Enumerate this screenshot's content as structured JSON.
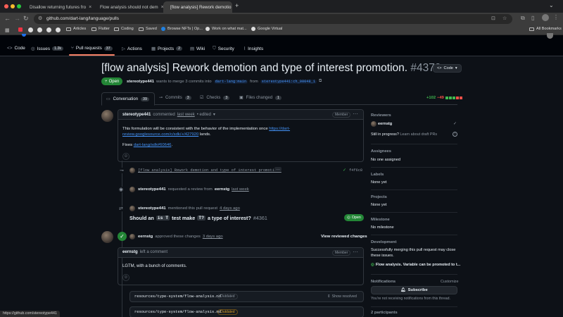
{
  "browser": {
    "tabs": [
      {
        "label": "Disallow returning futures fro"
      },
      {
        "label": "Flow analysis should not dem"
      },
      {
        "label": "[flow analysis] Rework demotio"
      }
    ],
    "new_tab": "+",
    "url": "github.com/dart-lang/language/pulls",
    "bookmarks": [
      "Articles",
      "Flutter",
      "Coding",
      "Saved",
      "Browse NFTs | Op...",
      "Work on what mat...",
      "Google Virtual"
    ],
    "all_bookmarks": "All Bookmarks",
    "status_url": "https://github.com/stereotype441"
  },
  "repo_nav": {
    "items": [
      {
        "label": "Code",
        "icon": "code-icon"
      },
      {
        "label": "Issues",
        "count": "1.2k",
        "icon": "issue-icon"
      },
      {
        "label": "Pull requests",
        "count": "37",
        "icon": "pull-request-icon"
      },
      {
        "label": "Actions",
        "icon": "play-icon"
      },
      {
        "label": "Projects",
        "count": "2",
        "icon": "table-icon"
      },
      {
        "label": "Wiki",
        "icon": "book-icon"
      },
      {
        "label": "Security",
        "icon": "shield-icon"
      },
      {
        "label": "Insights",
        "icon": "graph-icon"
      }
    ]
  },
  "pr": {
    "title": "[flow analysis] Rework demotion and type of interest promotion.",
    "number": "#4370",
    "code_button": "Code",
    "state": "Open",
    "author": "stereotype441",
    "merge_text": "wants to merge 3 commits into",
    "base": "dart-lang:main",
    "from": "from",
    "head": "stereotype441:ch_00048_1",
    "diff_add": "+102",
    "diff_del": "−49",
    "tabs": [
      {
        "label": "Conversation",
        "count": "39"
      },
      {
        "label": "Commits",
        "count": "3"
      },
      {
        "label": "Checks",
        "count": "3"
      },
      {
        "label": "Files changed",
        "count": "1"
      }
    ]
  },
  "timeline": {
    "comment1": {
      "author": "stereotype441",
      "action": "commented",
      "time": "last week",
      "edited": "• edited",
      "role": "Member",
      "body_prefix": "This formulation will be consistent with the behavior of the implementation once",
      "body_link": "https://dart-review.googlesource.com/c/sdk/+/427920",
      "body_suffix": "lands.",
      "fixes": "Fixes",
      "fixes_link": "dart-lang/sdk#60646",
      "fixes_end": "."
    },
    "commit": {
      "message": "[flow analysis] Rework demotion and type of interest promotion.",
      "more": "…",
      "sha": "f4f6c8"
    },
    "review_request": {
      "author": "stereotype441",
      "text": "requested a review from",
      "reviewer": "eernstg",
      "time": "last week"
    },
    "mention": {
      "author": "stereotype441",
      "text": "mentioned this pull request",
      "time": "4 days ago",
      "issue_prefix": "Should an",
      "code1": "is T",
      "issue_mid": "test make",
      "code2": "T?",
      "issue_suffix": "a type of interest?",
      "issue_num": "#4361",
      "issue_state": "Open"
    },
    "approval": {
      "author": "eernstg",
      "text": "approved these changes",
      "time": "3 days ago",
      "button": "View reviewed changes"
    },
    "comment2": {
      "author": "eernstg",
      "action": "left a comment",
      "role": "Member",
      "body": "LGTM, with a bunch of comments."
    },
    "files": [
      {
        "path": "resources/type-system/flow-analysis.md",
        "status": "Outdated",
        "action": "Show resolved"
      },
      {
        "path": "resources/type-system/flow-analysis.md",
        "status": "Outdated"
      }
    ]
  },
  "sidebar": {
    "reviewers_title": "Reviewers",
    "reviewer": "eernstg",
    "in_progress": "Still in progress?",
    "draft_link": "Learn about draft PRs",
    "assignees_title": "Assignees",
    "assignees_value": "No one assigned",
    "labels_title": "Labels",
    "labels_value": "None yet",
    "projects_title": "Projects",
    "projects_value": "None yet",
    "milestone_title": "Milestone",
    "milestone_value": "No milestone",
    "development_title": "Development",
    "development_text": "Successfully merging this pull request may close these issues.",
    "linked_issue": "Flow analysis. Variable can be promoted to t...",
    "notifications_title": "Notifications",
    "customize": "Customize",
    "subscribe": "Subscribe",
    "notify_text": "You're not receiving notifications from this thread.",
    "participants": "2 participants"
  },
  "colors": {
    "accent": "#4493f8",
    "open_green": "#238636",
    "diff_add": "#3fb950",
    "diff_del": "#f85149"
  }
}
